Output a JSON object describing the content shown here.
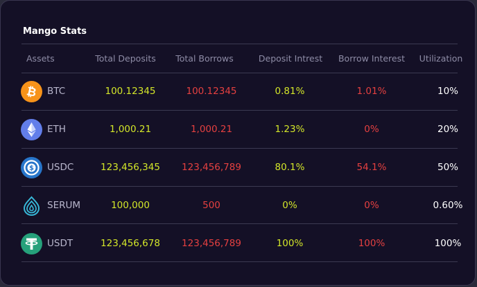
{
  "title": "Mango Stats",
  "headers": {
    "assets": "Assets",
    "total_deposits": "Total Deposits",
    "total_borrows": "Total Borrows",
    "deposit_interest": "Deposit Intrest",
    "borrow_interest": "Borrow Interest",
    "utilization": "Utilization"
  },
  "rows": [
    {
      "asset": "BTC",
      "icon": "bitcoin-icon",
      "deposits": "100.12345",
      "borrows": "100.12345",
      "deposit_rate": "0.81%",
      "borrow_rate": "1.01%",
      "utilization": "10%"
    },
    {
      "asset": "ETH",
      "icon": "ethereum-icon",
      "deposits": "1,000.21",
      "borrows": "1,000.21",
      "deposit_rate": "1.23%",
      "borrow_rate": "0%",
      "utilization": "20%"
    },
    {
      "asset": "USDC",
      "icon": "usdc-icon",
      "deposits": "123,456,345",
      "borrows": "123,456,789",
      "deposit_rate": "80.1%",
      "borrow_rate": "54.1%",
      "utilization": "50%"
    },
    {
      "asset": "SERUM",
      "icon": "serum-icon",
      "deposits": "100,000",
      "borrows": "500",
      "deposit_rate": "0%",
      "borrow_rate": "0%",
      "utilization": "0.60%"
    },
    {
      "asset": "USDT",
      "icon": "tether-icon",
      "deposits": "123,456,678",
      "borrows": "123,456,789",
      "deposit_rate": "100%",
      "borrow_rate": "100%",
      "utilization": "100%"
    }
  ],
  "colors": {
    "positive": "#d3e629",
    "negative": "#e54040",
    "background": "#141026"
  }
}
